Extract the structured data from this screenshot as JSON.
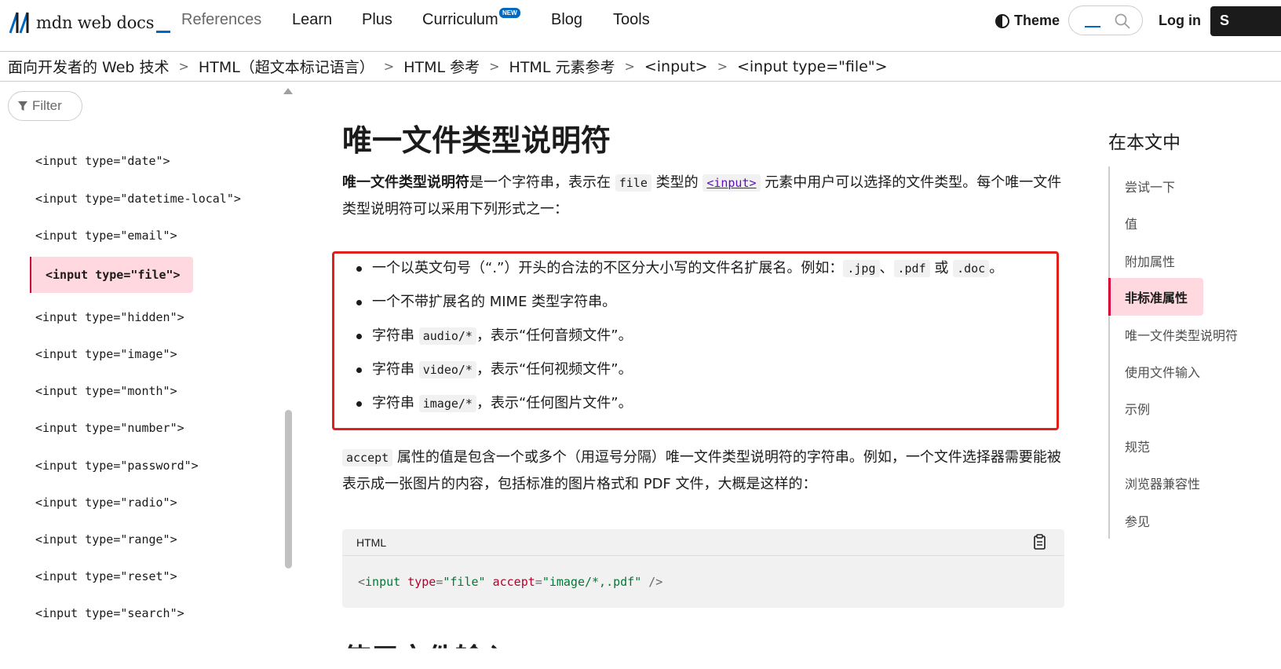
{
  "nav": {
    "logo_text": "mdn web docs",
    "items": [
      "References",
      "Learn",
      "Plus",
      "Curriculum",
      "Blog",
      "Tools"
    ],
    "new_badge": "NEW",
    "theme_label": "Theme",
    "login_label": "Log in",
    "signup_label": "S"
  },
  "breadcrumb": [
    "面向开发者的 Web 技术",
    "HTML（超文本标记语言）",
    "HTML 参考",
    "HTML 元素参考",
    "<input>",
    "<input type=\"file\">"
  ],
  "sidebar": {
    "filter_placeholder": "Filter",
    "items": [
      "<input type=\"date\">",
      "<input type=\"datetime-local\">",
      "<input type=\"email\">",
      "<input type=\"file\">",
      "<input type=\"hidden\">",
      "<input type=\"image\">",
      "<input type=\"month\">",
      "<input type=\"number\">",
      "<input type=\"password\">",
      "<input type=\"radio\">",
      "<input type=\"range\">",
      "<input type=\"reset\">",
      "<input type=\"search\">"
    ],
    "active_index": 3
  },
  "main": {
    "title": "唯一文件类型说明符",
    "intro": {
      "bold": "唯一文件类型说明符",
      "t1": "是一个字符串，表示在 ",
      "code1": "file",
      "t2": " 类型的 ",
      "link": "<input>",
      "t3": " 元素中用户可以选择的文件类型。每个唯一文件类型说明符可以采用下列形式之一："
    },
    "bullets": {
      "b1_t1": "一个以英文句号（“.”）开头的合法的不区分大小写的文件名扩展名。例如：",
      "b1_c1": ".jpg",
      "b1_sep": "、",
      "b1_c2": ".pdf",
      "b1_or": " 或 ",
      "b1_c3": ".doc",
      "b1_end": "。",
      "b2": "一个不带扩展名的 MIME 类型字符串。",
      "b3_t1": "字符串 ",
      "b3_code": "audio/*",
      "b3_t2": "，表示“任何音频文件”。",
      "b4_t1": "字符串 ",
      "b4_code": "video/*",
      "b4_t2": "，表示“任何视频文件”。",
      "b5_t1": "字符串 ",
      "b5_code": "image/*",
      "b5_t2": "，表示“任何图片文件”。"
    },
    "accept_para": {
      "code": "accept",
      "text": " 属性的值是包含一个或多个（用逗号分隔）唯一文件类型说明符的字符串。例如，一个文件选择器需要能被表示成一张图片的内容，包括标准的图片格式和 PDF 文件，大概是这样的："
    },
    "codeblock": {
      "lang": "HTML",
      "open": "<",
      "tag": "input",
      "attr1": "type",
      "eq": "=",
      "val1": "\"file\"",
      "attr2": "accept",
      "val2": "\"image/*,.pdf\"",
      "close": " />"
    },
    "next_heading": "使用文件输入"
  },
  "toc": {
    "title": "在本文中",
    "items": [
      "尝试一下",
      "值",
      "附加属性",
      "非标准属性",
      "唯一文件类型说明符",
      "使用文件输入",
      "示例",
      "规范",
      "浏览器兼容性",
      "参见"
    ],
    "active_index": 3
  },
  "colors": {
    "accent": "#0069c2",
    "active_bg": "#ffd9df",
    "active_border": "#d30038",
    "highlight_box": "#e0201b"
  }
}
